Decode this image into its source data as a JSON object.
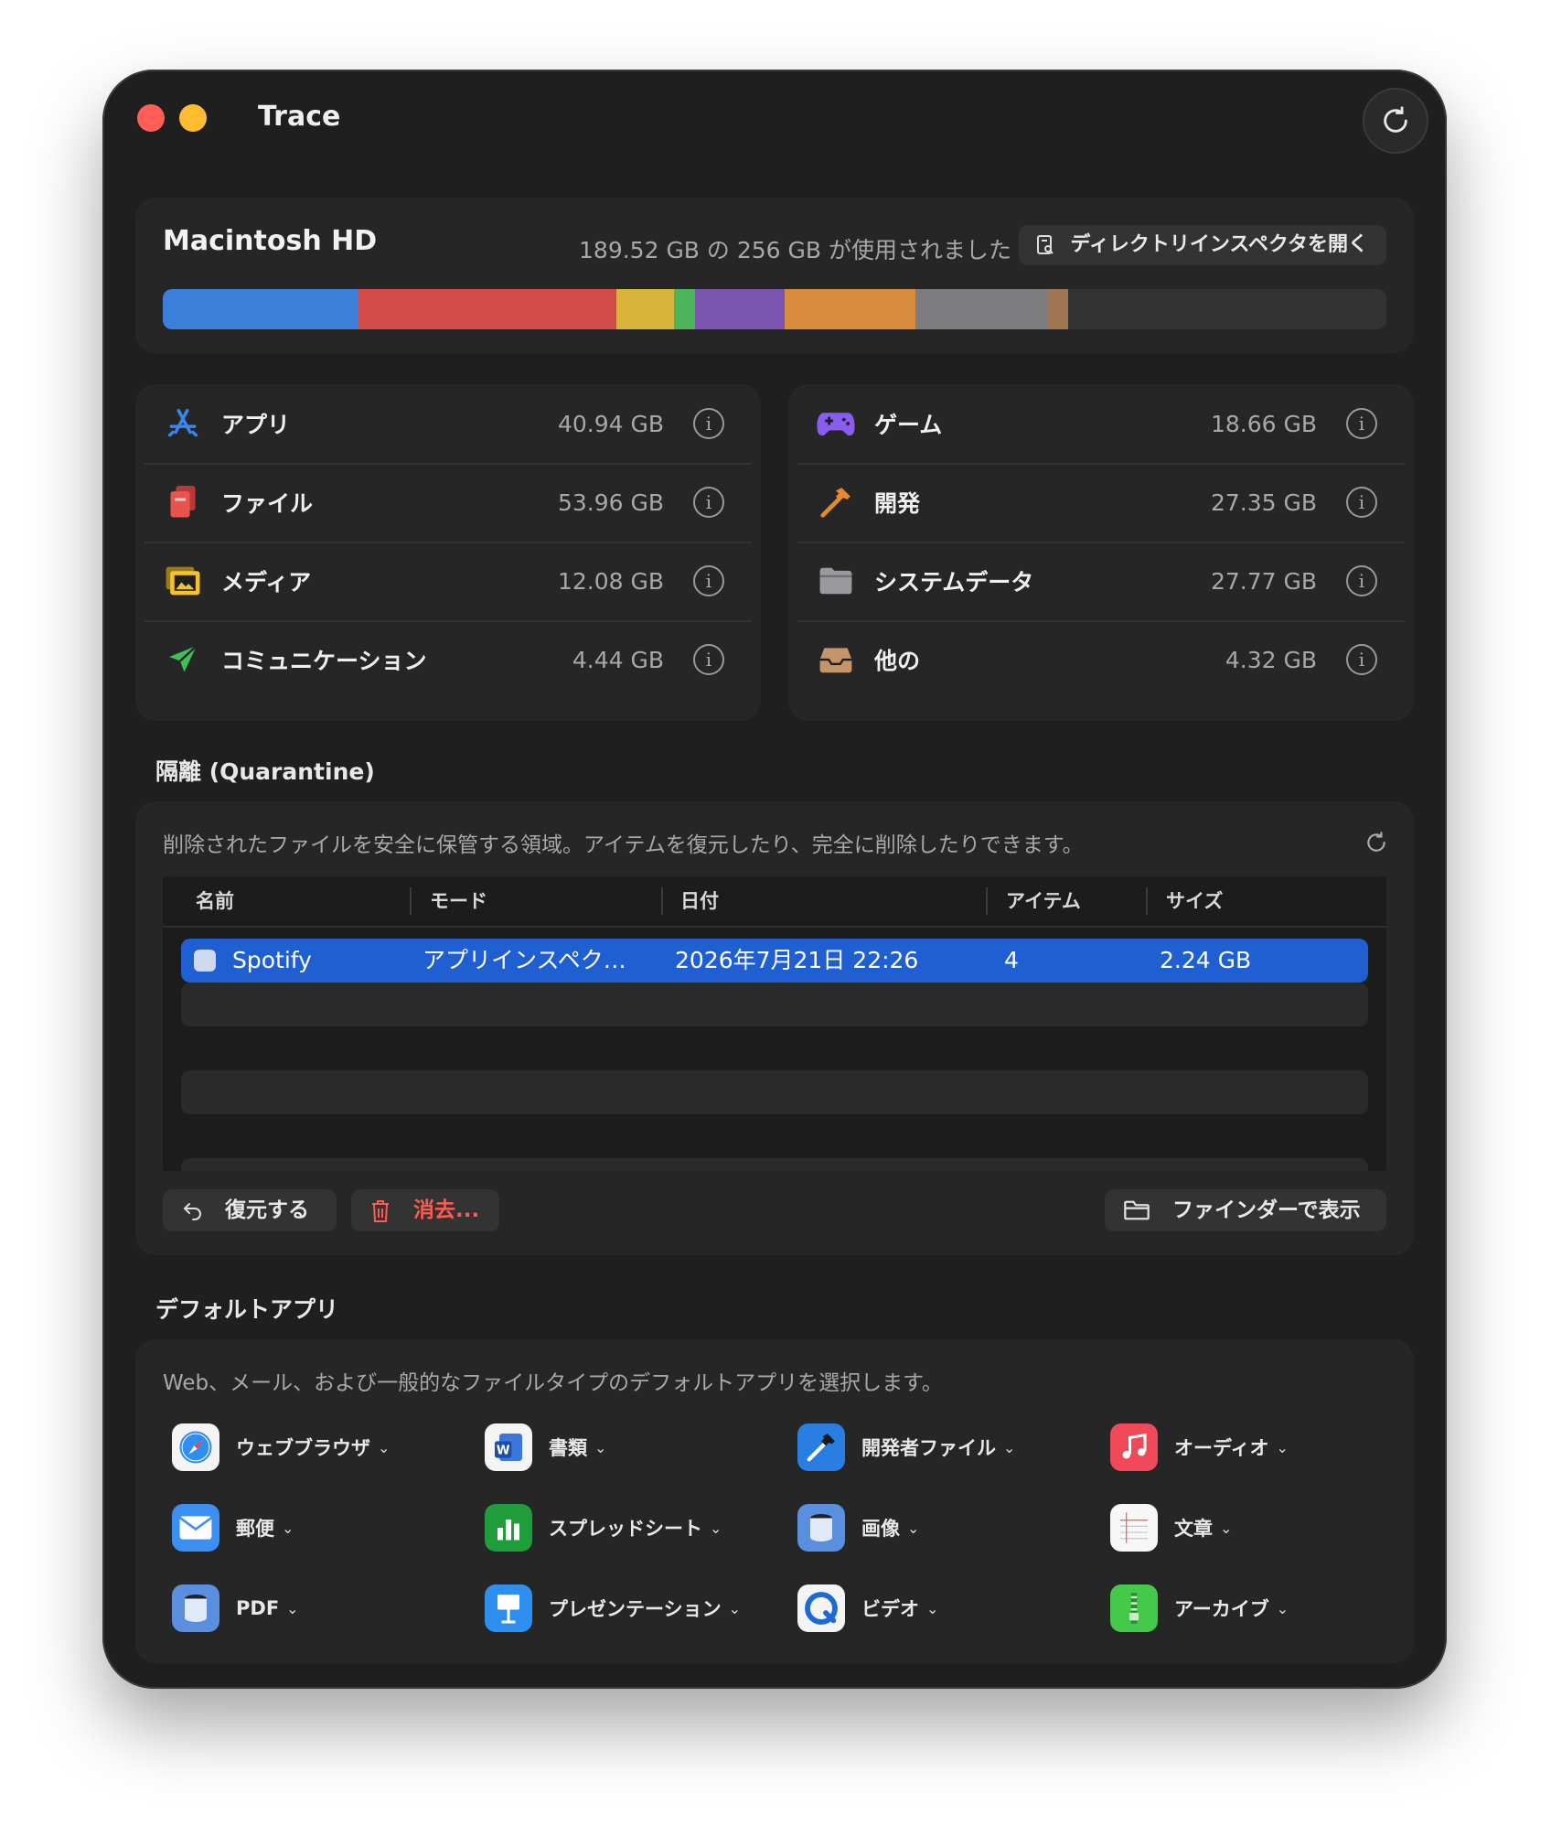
{
  "window": {
    "title": "Trace"
  },
  "disk": {
    "name": "Macintosh HD",
    "usage_text": "189.52 GB の 256 GB が使用されました",
    "open_inspector_label": "ディレクトリインスペクタを開く",
    "segments": [
      {
        "category": "アプリ",
        "fraction": 0.16,
        "color": "#3a7fd9"
      },
      {
        "category": "ファイル",
        "fraction": 0.211,
        "color": "#d14b48"
      },
      {
        "category": "メディア",
        "fraction": 0.047,
        "color": "#d9b43a"
      },
      {
        "category": "コミュニケーション",
        "fraction": 0.017,
        "color": "#4cb35a"
      },
      {
        "category": "ゲーム",
        "fraction": 0.073,
        "color": "#7c55b3"
      },
      {
        "category": "開発",
        "fraction": 0.107,
        "color": "#d98b3e"
      },
      {
        "category": "システムデータ",
        "fraction": 0.108,
        "color": "#7d7d80"
      },
      {
        "category": "他の",
        "fraction": 0.017,
        "color": "#a07752"
      }
    ]
  },
  "categories": {
    "left": [
      {
        "label": "アプリ",
        "size": "40.94 GB",
        "icon": "app-store-icon"
      },
      {
        "label": "ファイル",
        "size": "53.96 GB",
        "icon": "documents-icon"
      },
      {
        "label": "メディア",
        "size": "12.08 GB",
        "icon": "photos-icon"
      },
      {
        "label": "コミュニケーション",
        "size": "4.44 GB",
        "icon": "paper-plane-icon"
      }
    ],
    "right": [
      {
        "label": "ゲーム",
        "size": "18.66 GB",
        "icon": "gamepad-icon"
      },
      {
        "label": "開発",
        "size": "27.35 GB",
        "icon": "hammer-icon"
      },
      {
        "label": "システムデータ",
        "size": "27.77 GB",
        "icon": "folder-icon"
      },
      {
        "label": "他の",
        "size": "4.32 GB",
        "icon": "tray-icon"
      }
    ]
  },
  "quarantine": {
    "section_title": "隔離 (Quarantine)",
    "description": "削除されたファイルを安全に保管する領域。アイテムを復元したり、完全に削除したりできます。",
    "columns": [
      "名前",
      "モード",
      "日付",
      "アイテム",
      "サイズ"
    ],
    "rows": [
      {
        "name": "Spotify",
        "mode": "アプリインスペク…",
        "date": "2026年7月21日 22:26",
        "items": "4",
        "size": "2.24 GB"
      }
    ],
    "restore_label": "復元する",
    "delete_label": "消去...",
    "finder_label": "ファインダーで表示"
  },
  "defaults": {
    "section_title": "デフォルトアプリ",
    "description": "Web、メール、および一般的なファイルタイプのデフォルトアプリを選択します。",
    "items": [
      {
        "label": "ウェブブラウザ",
        "icon": "safari-icon"
      },
      {
        "label": "書類",
        "icon": "word-icon"
      },
      {
        "label": "開発者ファイル",
        "icon": "xcode-icon"
      },
      {
        "label": "オーディオ",
        "icon": "music-icon"
      },
      {
        "label": "郵便",
        "icon": "mail-icon"
      },
      {
        "label": "スプレッドシート",
        "icon": "numbers-icon"
      },
      {
        "label": "画像",
        "icon": "preview-icon"
      },
      {
        "label": "文章",
        "icon": "textedit-icon"
      },
      {
        "label": "PDF",
        "icon": "preview-pdf-icon"
      },
      {
        "label": "プレゼンテーション",
        "icon": "keynote-icon"
      },
      {
        "label": "ビデオ",
        "icon": "quicktime-icon"
      },
      {
        "label": "アーカイブ",
        "icon": "archive-utility-icon"
      }
    ]
  },
  "colors": {
    "accent": "#1f5fd1",
    "danger": "#ff5a52",
    "window_bg": "#1f1f1f"
  }
}
